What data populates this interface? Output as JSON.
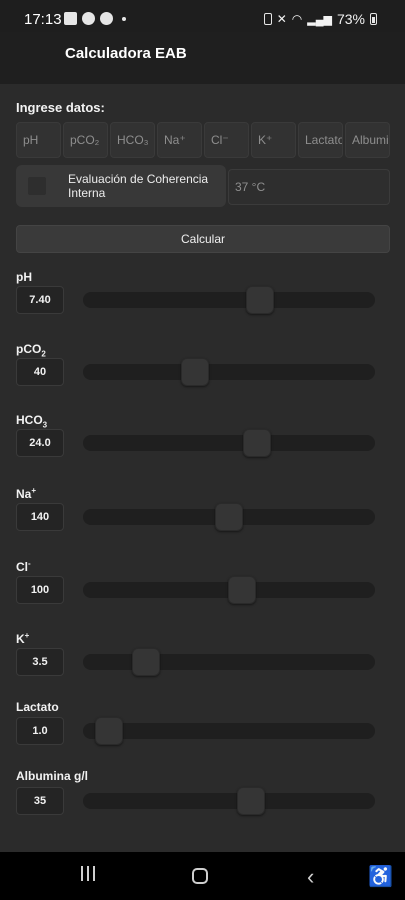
{
  "status_bar": {
    "time": "17:13",
    "battery": "73%"
  },
  "app_title": "Calculadora EAB",
  "section_label": "Ingrese datos:",
  "input_chips": [
    "pH",
    "pCO₂",
    "HCO₃",
    "Na⁺",
    "Cl⁻",
    "K⁺",
    "Lactato",
    "Albumina"
  ],
  "coherence_label": "Evaluación de Coherencia Interna",
  "temperature_placeholder": "37 °C",
  "calc_button": "Calcular",
  "params": [
    {
      "label_main": "pH",
      "label_sub": "",
      "label_sup": "",
      "value": "7.40",
      "fraction": 0.605
    },
    {
      "label_main": "pCO",
      "label_sub": "2",
      "label_sup": "",
      "value": "40",
      "fraction": 0.385
    },
    {
      "label_main": "HCO",
      "label_sub": "3",
      "label_sup": "",
      "value": "24.0",
      "fraction": 0.595
    },
    {
      "label_main": "Na",
      "label_sub": "",
      "label_sup": "+",
      "value": "140",
      "fraction": 0.5
    },
    {
      "label_main": "Cl",
      "label_sub": "",
      "label_sup": "-",
      "value": "100",
      "fraction": 0.545
    },
    {
      "label_main": "K",
      "label_sub": "",
      "label_sup": "+",
      "value": "3.5",
      "fraction": 0.215
    },
    {
      "label_main": "Lactato",
      "label_sub": "",
      "label_sup": "",
      "value": "1.0",
      "fraction": 0.09
    },
    {
      "label_main": "Albumina g/l",
      "label_sub": "",
      "label_sup": "",
      "value": "35",
      "fraction": 0.575
    }
  ],
  "icons": [
    "linkedin-icon",
    "pinwheel-icon",
    "chat-icon",
    "battery-icon",
    "mute-icon",
    "wifi-icon",
    "signal-icon"
  ]
}
